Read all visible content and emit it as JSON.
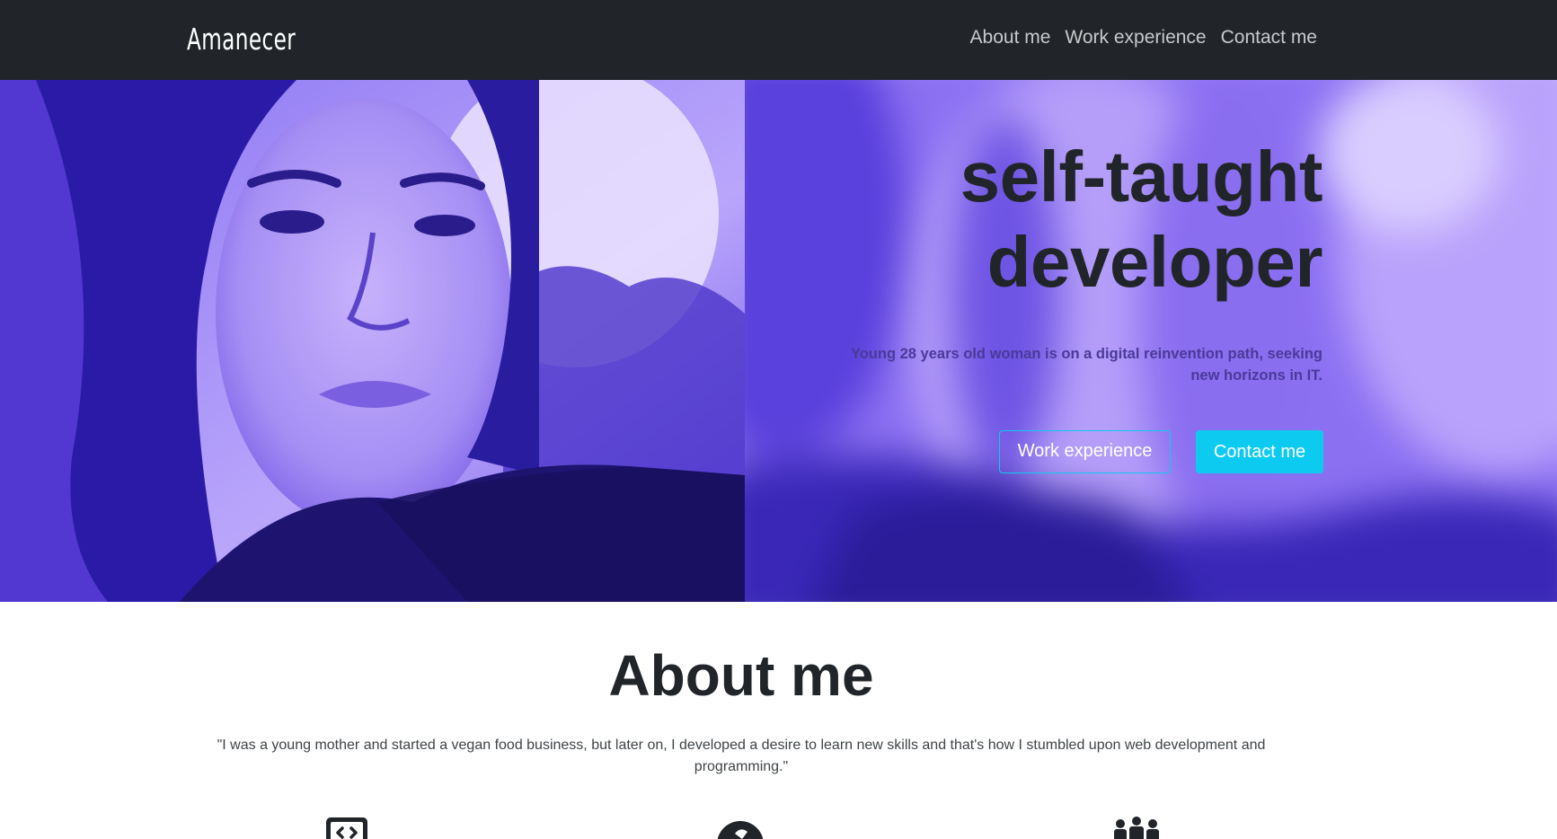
{
  "navbar": {
    "brand": "Amanecer",
    "links": [
      "About me",
      "Work experience",
      "Contact me"
    ]
  },
  "hero": {
    "title_line1": "self-taught",
    "title_line2": "developer",
    "subtitle_line1": "Young 28 years old woman is on a digital reinvention path, seeking",
    "subtitle_line2": "new horizons in IT.",
    "button_outline": "Work experience",
    "button_solid": "Contact me"
  },
  "about": {
    "title": "About me",
    "quote_line1": "\"I was a young mother and started a vegan food business, but later on, I developed a desire to learn new skills and that's how I stumbled upon web development and",
    "quote_line2": "programming.\"",
    "feature_icons": [
      "code-icon",
      "circle-badge-icon",
      "team-icon"
    ]
  },
  "colors": {
    "navbar_bg": "#212529",
    "accent": "#0dcaf0",
    "hero_tint": "#6f4df0"
  }
}
